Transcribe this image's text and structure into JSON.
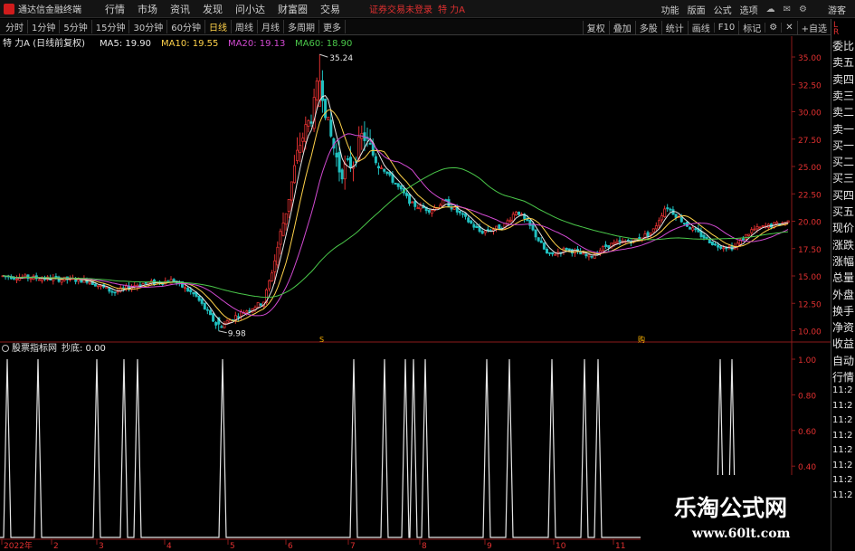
{
  "titlebar": {
    "app_title": "通达信金融终端",
    "menu": [
      "行情",
      "市场",
      "资讯",
      "发现",
      "问小达",
      "财富圈",
      "交易"
    ],
    "login_status": "证券交易未登录",
    "stock_name": "特 力A",
    "right_links": [
      "功能",
      "版面",
      "公式",
      "选项"
    ],
    "guest": "游客"
  },
  "toolbar": {
    "period_tabs": [
      "分时",
      "1分钟",
      "5分钟",
      "15分钟",
      "30分钟",
      "60分钟",
      "日线",
      "周线",
      "月线",
      "多周期",
      "更多"
    ],
    "active_tab": "日线",
    "right_buttons": [
      "复权",
      "叠加",
      "多股",
      "统计",
      "画线",
      "F10",
      "标记"
    ],
    "add_button": "+自选"
  },
  "main_chart": {
    "legend_title": "特 力A (日线前复权)",
    "ma_items": [
      {
        "label": "MA5: 19.90",
        "color": "#e8e8e8"
      },
      {
        "label": "MA10: 19.55",
        "color": "#ffd24a"
      },
      {
        "label": "MA20: 19.13",
        "color": "#d24ad2"
      },
      {
        "label": "MA60: 18.90",
        "color": "#4ac84a"
      }
    ],
    "y_ticks": [
      "35.00",
      "32.50",
      "30.00",
      "27.50",
      "25.00",
      "22.50",
      "20.00",
      "17.50",
      "15.00",
      "12.50",
      "10.00"
    ],
    "high_label": "35.24",
    "low_label": "9.98",
    "event_markers": [
      "S",
      "购"
    ]
  },
  "indicator_panel": {
    "legend": "股票指标网",
    "value_label": "抄底: 0.00",
    "y_ticks": [
      "1.00",
      "0.80",
      "0.60",
      "0.40"
    ]
  },
  "x_axis": {
    "labels": [
      "2022年",
      "2",
      "3",
      "4",
      "5",
      "6",
      "7",
      "8",
      "9",
      "10",
      "11"
    ]
  },
  "right_panel": {
    "top_l": "L",
    "top_r": "R",
    "items": [
      "委比",
      "卖五",
      "卖四",
      "卖三",
      "卖二",
      "卖一",
      "买一",
      "买二",
      "买三",
      "买四",
      "买五",
      "现价",
      "涨跌",
      "涨幅",
      "总量",
      "外盘",
      "换手",
      "净资",
      "收益",
      "自动",
      "行情"
    ],
    "times": [
      "11:2",
      "11:2",
      "11:2",
      "11:2",
      "11:2",
      "11:2",
      "11:2",
      "11:2"
    ]
  },
  "watermark": {
    "title": "乐淘公式网",
    "url": "www.60lt.com"
  },
  "colors": {
    "up": "#e03030",
    "down": "#20c0c0",
    "ma5": "#e8e8e8",
    "ma10": "#ffd24a",
    "ma20": "#d24ad2",
    "ma60": "#4ac84a",
    "axis": "#8b1a1a"
  }
}
